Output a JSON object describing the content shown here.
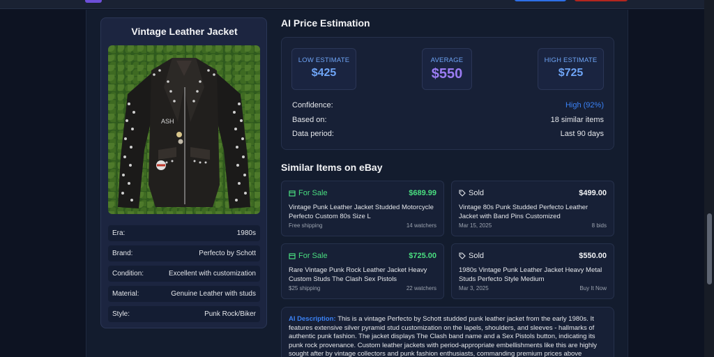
{
  "item": {
    "title": "Vintage Leather Jacket",
    "photo_alt": "Studded black leather jacket on a hedge background",
    "specs": [
      {
        "label": "Era:",
        "value": "1980s"
      },
      {
        "label": "Brand:",
        "value": "Perfecto by Schott"
      },
      {
        "label": "Condition:",
        "value": "Excellent with customization"
      },
      {
        "label": "Material:",
        "value": "Genuine Leather with studs"
      },
      {
        "label": "Style:",
        "value": "Punk Rock/Biker"
      }
    ]
  },
  "estimation": {
    "title": "AI Price Estimation",
    "low_label": "LOW ESTIMATE",
    "low_value": "$425",
    "avg_label": "AVERAGE",
    "avg_value": "$550",
    "high_label": "HIGH ESTIMATE",
    "high_value": "$725",
    "confidence_label": "Confidence:",
    "confidence_value": "High (92%)",
    "based_label": "Based on:",
    "based_value": "18 similar items",
    "period_label": "Data period:",
    "period_value": "Last 90 days"
  },
  "similar": {
    "title": "Similar Items on eBay",
    "items": [
      {
        "status": "For Sale",
        "price": "$689.99",
        "title": "Vintage Punk Leather Jacket Studded Motorcycle Perfecto Custom 80s Size L",
        "foot_left": "Free shipping",
        "foot_right": "14 watchers"
      },
      {
        "status": "Sold",
        "price": "$499.00",
        "title": "Vintage 80s Punk Studded Perfecto Leather Jacket with Band Pins Customized",
        "foot_left": "Mar 15, 2025",
        "foot_right": "8 bids"
      },
      {
        "status": "For Sale",
        "price": "$725.00",
        "title": "Rare Vintage Punk Rock Leather Jacket Heavy Custom Studs The Clash Sex Pistols",
        "foot_left": "$25 shipping",
        "foot_right": "22 watchers"
      },
      {
        "status": "Sold",
        "price": "$550.00",
        "title": "1980s Vintage Punk Leather Jacket Heavy Metal Studs Perfecto Style Medium",
        "foot_left": "Mar 3, 2025",
        "foot_right": "Buy It Now"
      }
    ]
  },
  "description": {
    "label": "AI Description:",
    "text": "This is a vintage Perfecto by Schott studded punk leather jacket from the early 1980s. It features extensive silver pyramid stud customization on the lapels, shoulders, and sleeves - hallmarks of authentic punk fashion. The jacket displays The Clash band name and a Sex Pistols button, indicating its punk rock provenance. Custom leather jackets with period-appropriate embellishments like this are highly sought after by vintage collectors and punk fashion enthusiasts, commanding premium prices above"
  },
  "colors": {
    "accent_blue": "#3b82f6",
    "sale_green": "#4ade80",
    "average_purple": "#9b7cf2"
  }
}
